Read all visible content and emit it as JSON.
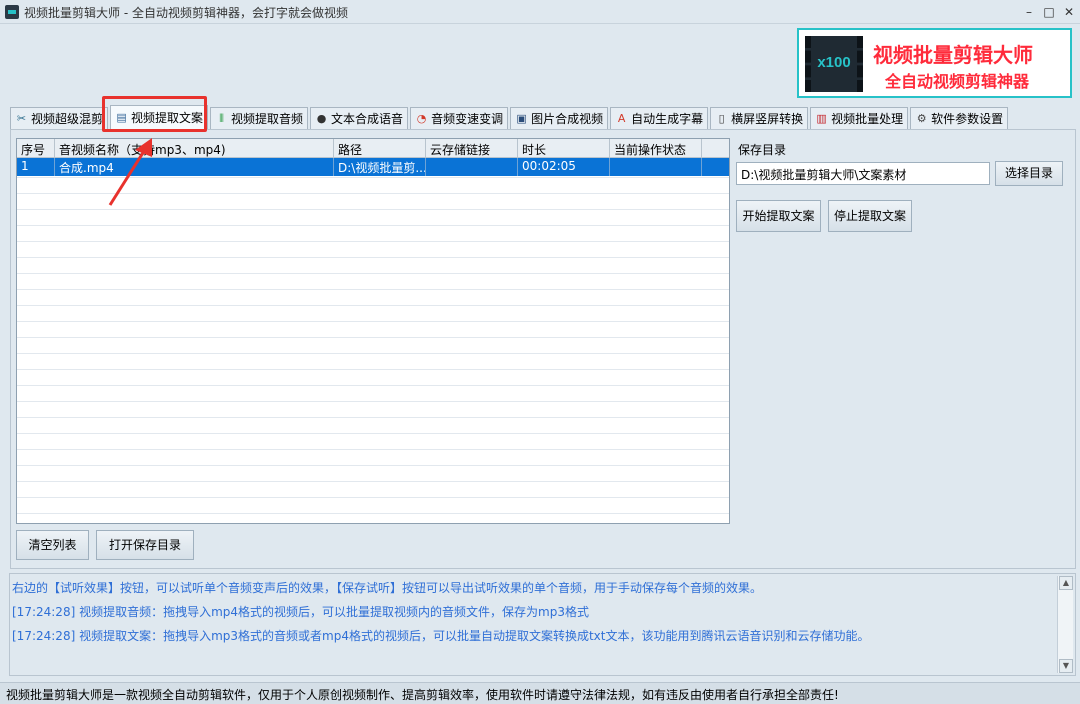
{
  "window": {
    "title": "视频批量剪辑大师 - 全自动视频剪辑神器，会打字就会做视频",
    "minimize": "–",
    "maximize": "□",
    "close": "✕"
  },
  "brand": {
    "badge": "x100",
    "line1": "视频批量剪辑大师",
    "line2": "全自动视频剪辑神器",
    "color": "#ff2b3b",
    "accent": "#27c2c8"
  },
  "tabs": [
    {
      "label": "视频超级混剪",
      "icon": "scissors-icon"
    },
    {
      "label": "视频提取文案",
      "icon": "document-icon",
      "active": true
    },
    {
      "label": "视频提取音频",
      "icon": "audio-bars-icon"
    },
    {
      "label": "文本合成语音",
      "icon": "microphone-icon"
    },
    {
      "label": "音频变速变调",
      "icon": "gauge-icon"
    },
    {
      "label": "图片合成视频",
      "icon": "picture-icon"
    },
    {
      "label": "自动生成字幕",
      "icon": "font-icon"
    },
    {
      "label": "横屏竖屏转换",
      "icon": "rotate-screen-icon"
    },
    {
      "label": "视频批量处理",
      "icon": "film-icon"
    },
    {
      "label": "软件参数设置",
      "icon": "gear-icon"
    }
  ],
  "grid": {
    "columns": [
      "序号",
      "音视频名称（支持mp3、mp4)",
      "路径",
      "云存储链接",
      "时长",
      "当前操作状态"
    ],
    "rows": [
      {
        "index": "1",
        "name": "合成.mp4",
        "path": "D:\\视频批量剪...",
        "cloud": "",
        "duration": "00:02:05",
        "status": ""
      }
    ]
  },
  "save": {
    "label": "保存目录",
    "dir": "D:\\视频批量剪辑大师\\文案素材",
    "choose_button": "选择目录",
    "start_button": "开始提取文案",
    "stop_button": "停止提取文案"
  },
  "bottom_buttons": {
    "clear": "清空列表",
    "open_dir": "打开保存目录"
  },
  "log": [
    "右边的【试听效果】按钮，可以试听单个音频变声后的效果，【保存试听】按钮可以导出试听效果的单个音频，用于手动保存每个音频的效果。",
    "[17:24:28] 视频提取音频：拖拽导入mp4格式的视频后，可以批量提取视频内的音频文件，保存为mp3格式",
    "[17:24:28] 视频提取文案：拖拽导入mp3格式的音频或者mp4格式的视频后，可以批量自动提取文案转换成txt文本，该功能用到腾讯云语音识别和云存储功能。"
  ],
  "status_bar": "视频批量剪辑大师是一款视频全自动剪辑软件，仅用于个人原创视频制作、提高剪辑效率，使用软件时请遵守法律法规，如有违反由使用者自行承担全部责任!",
  "colors": {
    "selection": "#0a73d6",
    "log_text": "#2f6fd6",
    "annotation": "#e8322d"
  }
}
